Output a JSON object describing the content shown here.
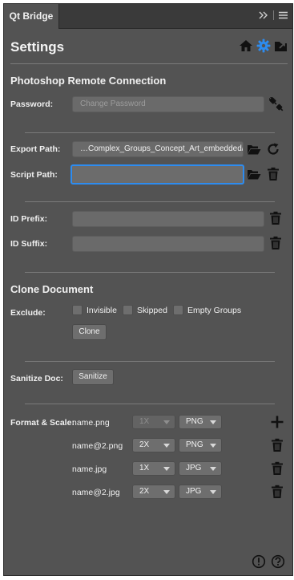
{
  "tab": {
    "label": "Qt Bridge"
  },
  "header": {
    "title": "Settings"
  },
  "remote": {
    "section": "Photoshop Remote Connection",
    "password_label": "Password:",
    "password_placeholder": "Change Password"
  },
  "paths": {
    "export_label": "Export Path:",
    "export_value": "…Complex_Groups_Concept_Art_embedded/",
    "script_label": "Script Path:",
    "script_value": ""
  },
  "ids": {
    "prefix_label": "ID Prefix:",
    "suffix_label": "ID Suffix:"
  },
  "clone": {
    "section": "Clone Document",
    "exclude_label": "Exclude:",
    "options": [
      "Invisible",
      "Skipped",
      "Empty Groups"
    ],
    "button": "Clone"
  },
  "sanitize": {
    "label": "Sanitize Doc:",
    "button": "Sanitize"
  },
  "formats": {
    "label": "Format & Scale:",
    "rows": [
      {
        "name": "name.png",
        "scale": "1X",
        "format": "PNG",
        "scale_disabled": true
      },
      {
        "name": "name@2.png",
        "scale": "2X",
        "format": "PNG",
        "scale_disabled": false
      },
      {
        "name": "name.jpg",
        "scale": "1X",
        "format": "JPG",
        "scale_disabled": false
      },
      {
        "name": "name@2.jpg",
        "scale": "2X",
        "format": "JPG",
        "scale_disabled": false
      }
    ]
  },
  "colors": {
    "accent": "#2d8cf0",
    "panel": "#535353",
    "text": "#f0f0f0"
  },
  "icons": [
    "home-icon",
    "gear-icon",
    "export-icon",
    "connect-icon",
    "folder-icon",
    "refresh-icon",
    "trash-icon",
    "plus-icon",
    "warning-icon",
    "help-icon",
    "expand-icon",
    "menu-icon"
  ]
}
